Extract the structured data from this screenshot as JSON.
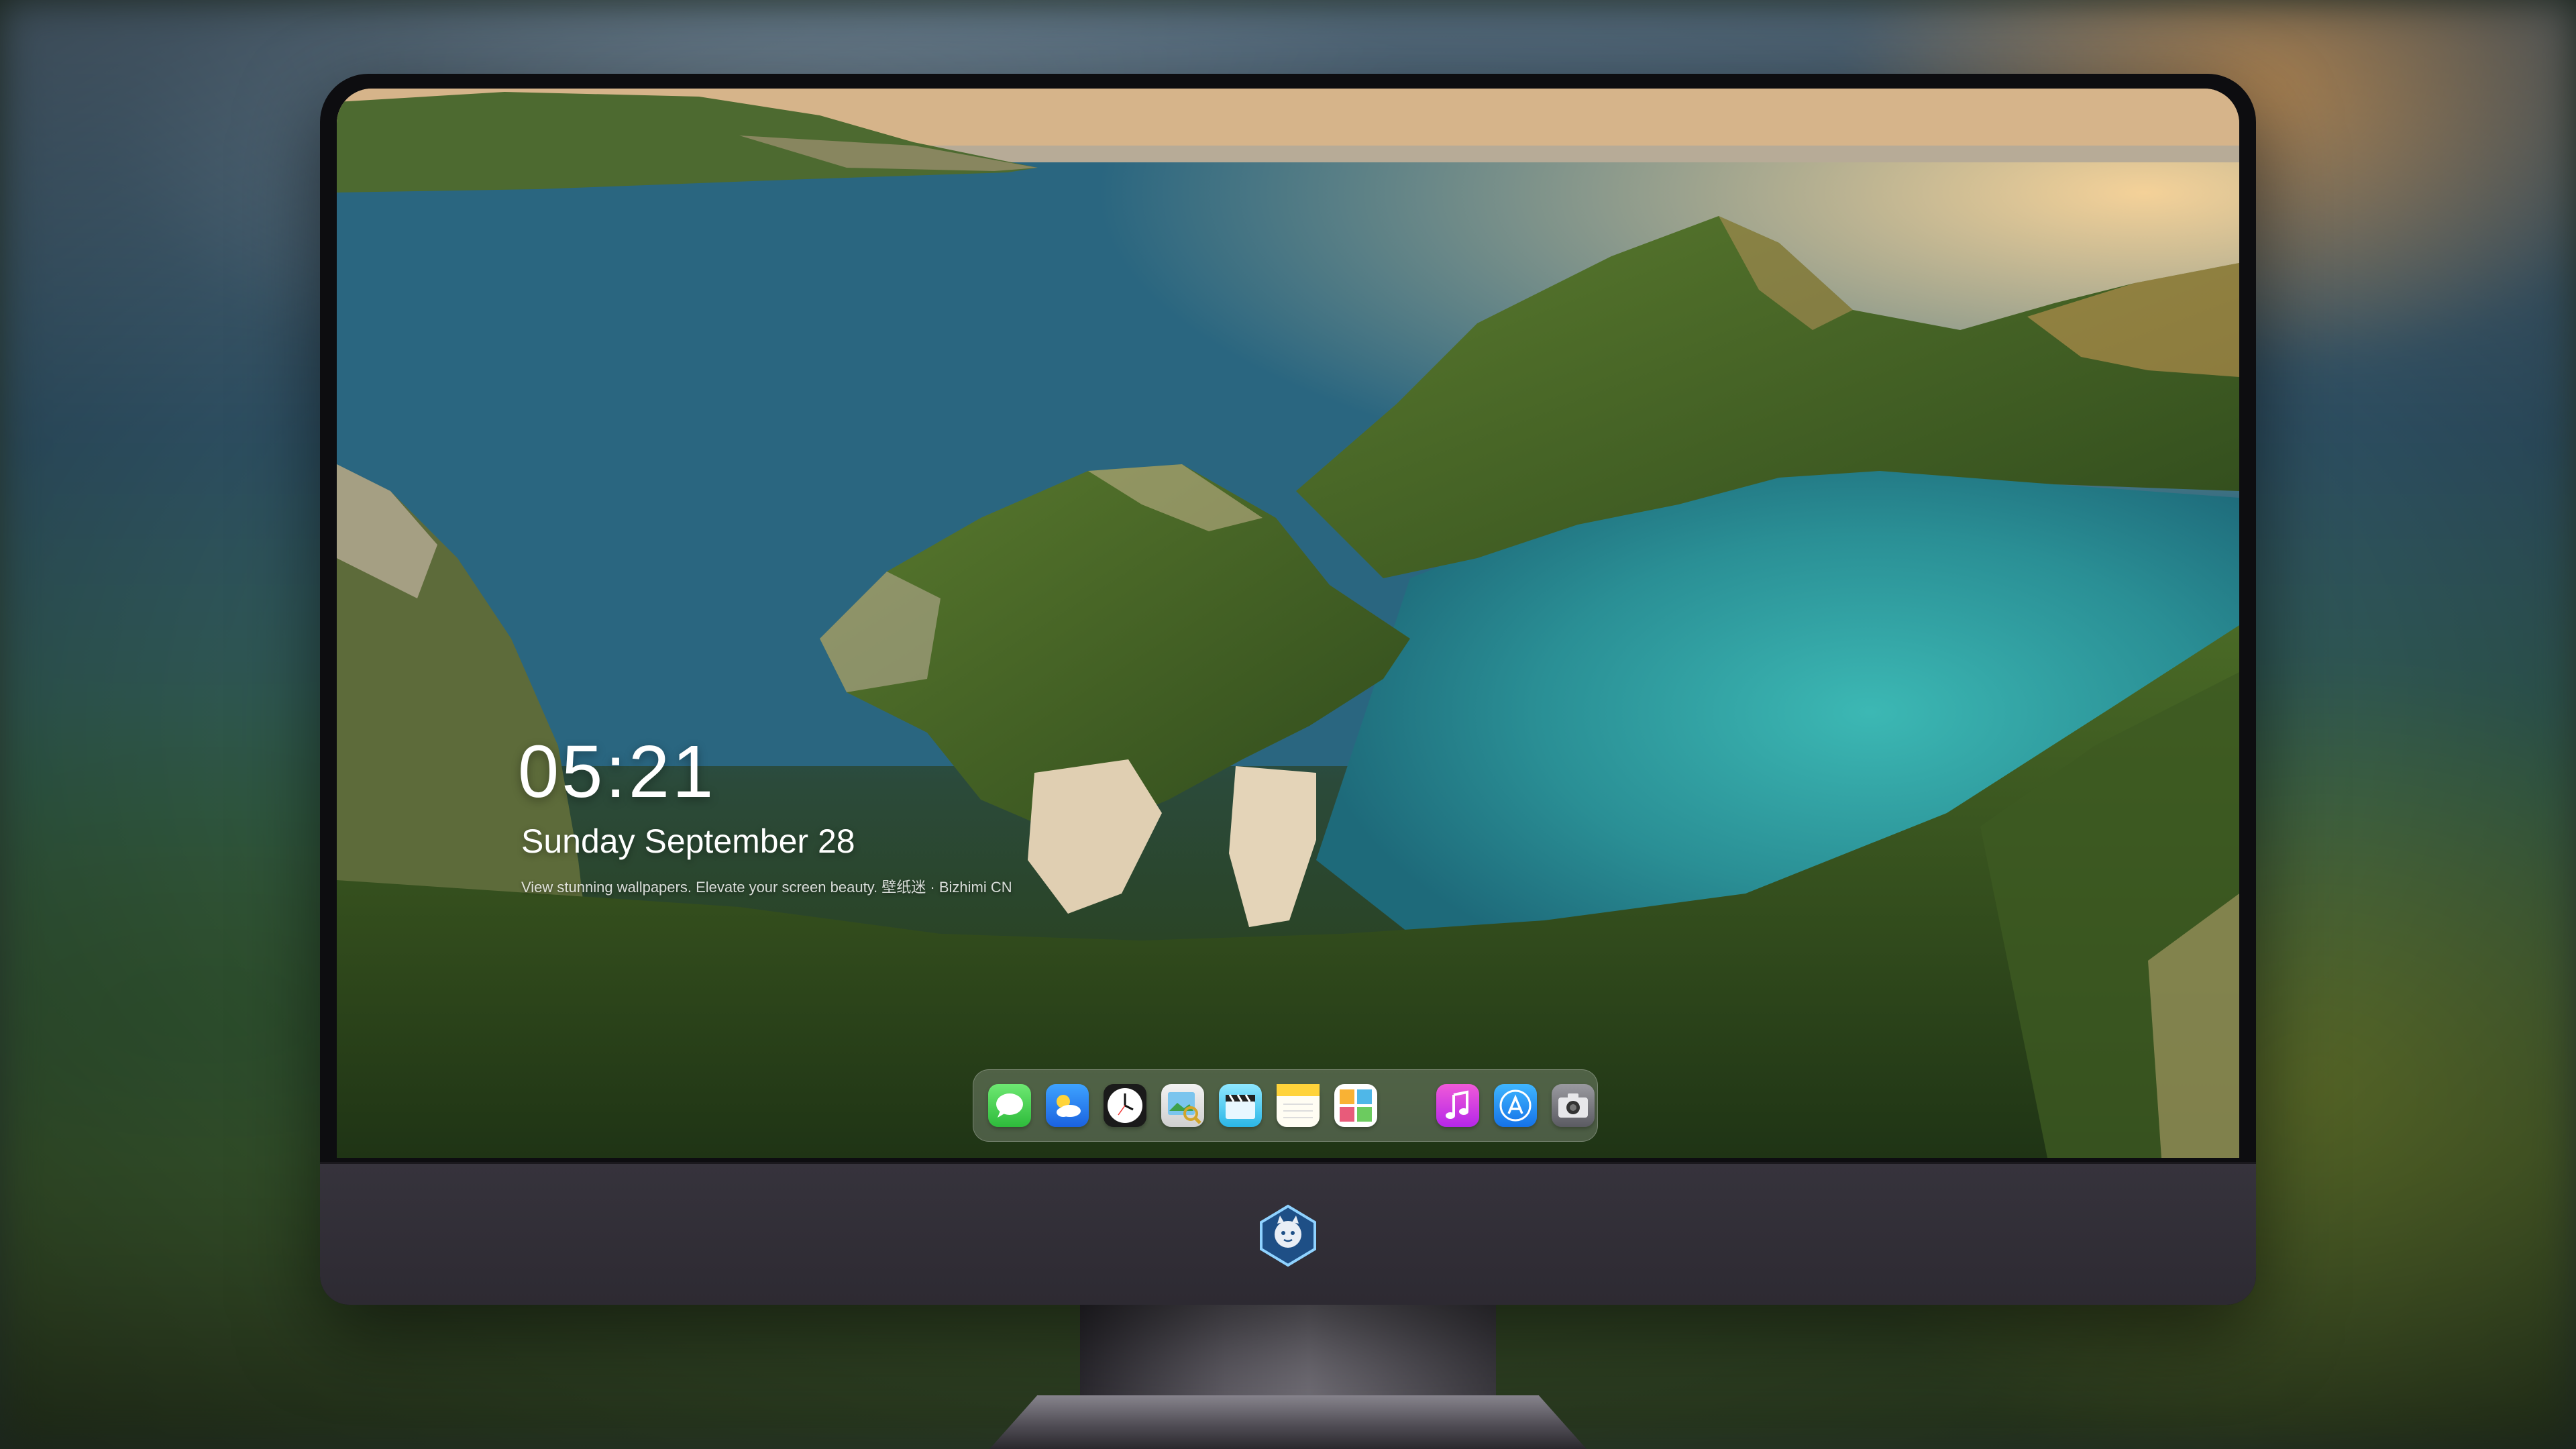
{
  "lock_screen": {
    "time": "05:21",
    "date": "Sunday September  28",
    "caption": "View stunning wallpapers. Elevate your screen beauty. 壁纸迷 · Bizhimi CN"
  },
  "dock": {
    "apps_main": [
      {
        "name": "Messages",
        "icon": "messages-icon"
      },
      {
        "name": "Weather",
        "icon": "weather-icon"
      },
      {
        "name": "Clock",
        "icon": "clock-icon"
      },
      {
        "name": "Preview",
        "icon": "preview-icon"
      },
      {
        "name": "Final Cut",
        "icon": "clapperboard-icon"
      },
      {
        "name": "Notes",
        "icon": "notes-icon"
      },
      {
        "name": "Photos",
        "icon": "photos-icon"
      }
    ],
    "apps_extra": [
      {
        "name": "Music",
        "icon": "music-icon"
      },
      {
        "name": "App Store",
        "icon": "app-store-icon"
      },
      {
        "name": "Camera",
        "icon": "camera-icon"
      }
    ]
  },
  "colors": {
    "sea": "#24617a",
    "lagoon": "#2fa5a6",
    "land": "#3d5a22",
    "sky": "#d9b583",
    "bezel": "#0d0d10",
    "chin": "#322f38"
  }
}
